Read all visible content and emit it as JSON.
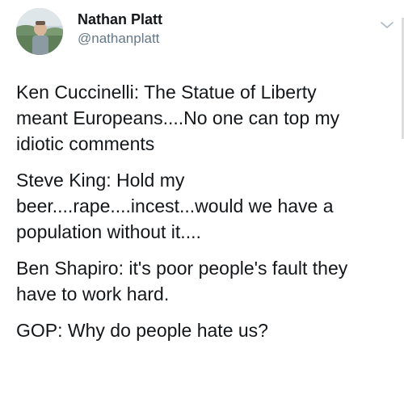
{
  "tweet": {
    "author": {
      "display_name": "Nathan Platt",
      "handle": "@nathanplatt"
    },
    "icons": {
      "menu": "chevron-down-icon",
      "avatar": "avatar-photo"
    },
    "paragraphs": [
      "Ken Cuccinelli: The Statue of Liberty\nmeant Europeans....No one can top my\nidiotic comments",
      "Steve King: Hold my\nbeer....rape....incest...would we have a\npopulation without it....",
      "Ben Shapiro: it's poor people's fault they\nhave to work hard.",
      "GOP: Why do people hate us?"
    ]
  },
  "colors": {
    "text": "#14171a",
    "secondary_text": "#657786",
    "chevron": "#aab8c2",
    "background": "#ffffff"
  }
}
